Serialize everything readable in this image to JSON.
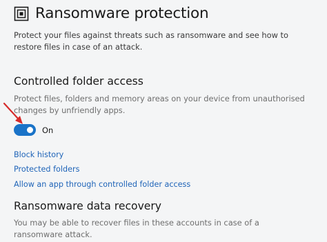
{
  "header": {
    "icon": "ransomware-shield-icon",
    "title": "Ransomware protection"
  },
  "intro": {
    "line1": "Protect your files against threats such as ransomware and see how to",
    "line2": "restore files in case of an attack."
  },
  "controlled_folder_access": {
    "heading": "Controlled folder access",
    "desc_line1": "Protect files, folders and memory areas on your device from unauthorised",
    "desc_line2": "changes by unfriendly apps.",
    "toggle": {
      "state": "on",
      "label": "On",
      "color": "#1a73c8"
    },
    "links": [
      {
        "label": "Block history"
      },
      {
        "label": "Protected folders"
      },
      {
        "label": "Allow an app through controlled folder access"
      }
    ]
  },
  "data_recovery": {
    "heading": "Ransomware data recovery",
    "desc_line1": "You may be able to recover files in these accounts in case of a",
    "desc_line2": "ransomware attack."
  },
  "annotation": {
    "icon": "red-arrow-icon",
    "color": "#d62b2b"
  },
  "colors": {
    "link": "#1f64b8",
    "background": "#f4f5f6"
  }
}
